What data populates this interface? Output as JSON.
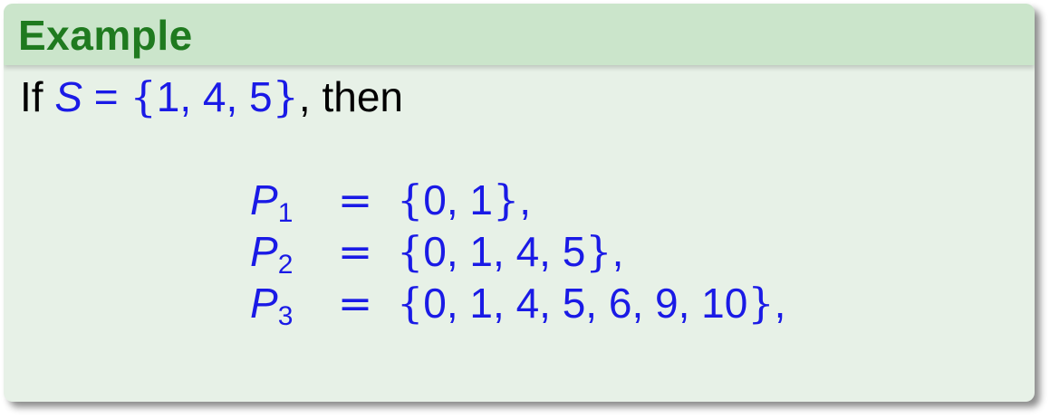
{
  "block": {
    "title": "Example"
  },
  "intro": {
    "prefix": "If ",
    "set_var": "S",
    "equals": " = ",
    "set_open": "{",
    "set_elems": "1, 4, 5",
    "set_close": "}",
    "suffix": ", then"
  },
  "equations": [
    {
      "var": "P",
      "sub": "1",
      "rel": "=",
      "open": "{",
      "elems": "0, 1",
      "close": "}",
      "tail": ","
    },
    {
      "var": "P",
      "sub": "2",
      "rel": "=",
      "open": "{",
      "elems": "0, 1, 4, 5",
      "close": "}",
      "tail": ","
    },
    {
      "var": "P",
      "sub": "3",
      "rel": "=",
      "open": "{",
      "elems": "0, 1, 4, 5, 6, 9, 10",
      "close": "}",
      "tail": ","
    }
  ],
  "colors": {
    "title_text": "#1f7a1f",
    "title_bar": "#cbe5cb",
    "body_bg": "#e7f1e7",
    "math_blue": "#1a1ae6"
  }
}
